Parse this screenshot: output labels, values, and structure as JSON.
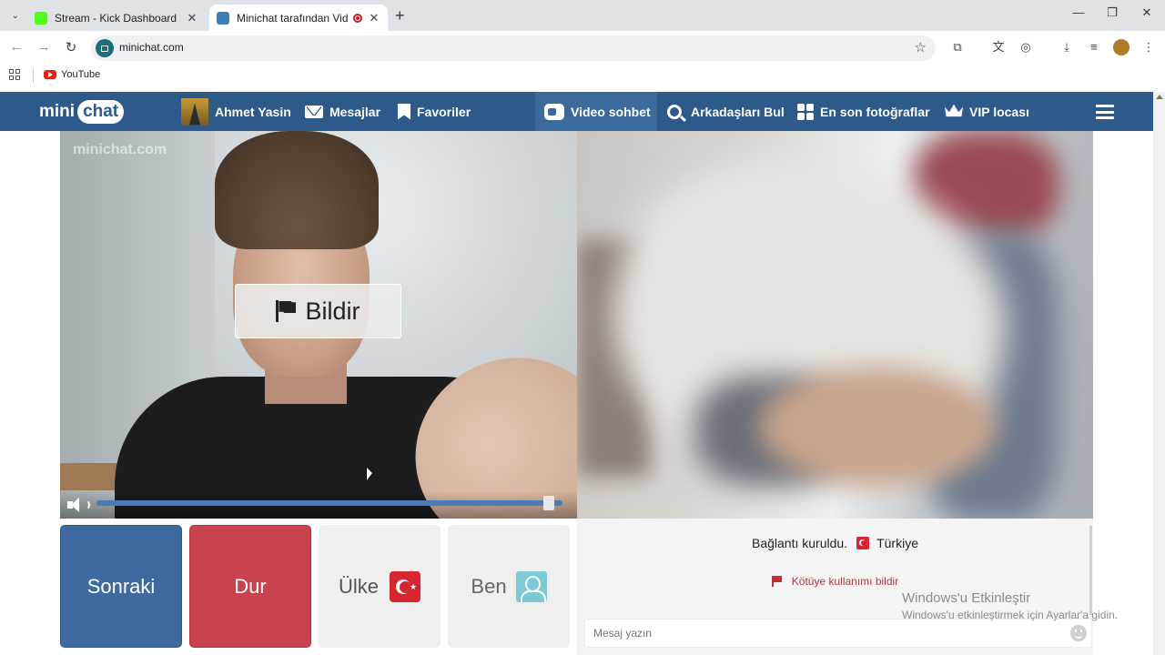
{
  "browser": {
    "tabs": [
      {
        "title": "Stream - Kick Dashboard",
        "favicon_color": "#53fc18",
        "active": false
      },
      {
        "title": "Minichat tarafından Video f",
        "favicon_color": "#3a7fb8",
        "active": true
      }
    ],
    "url": "minichat.com",
    "bookmarks": [
      {
        "label": "YouTube"
      }
    ]
  },
  "site": {
    "logo": {
      "mini": "mini",
      "chat": "chat",
      "watermark": "minichat.com"
    },
    "nav": {
      "user": "Ahmet Yasin",
      "messages": "Mesajlar",
      "favorites": "Favoriler",
      "video_chat": "Video sohbet",
      "find_friends": "Arkadaşları Bul",
      "latest_photos": "En son fotoğraflar",
      "vip": "VIP locası"
    },
    "video": {
      "report_label": "Bildir",
      "volume": 0.97
    },
    "controls": {
      "next": "Sonraki",
      "stop": "Dur",
      "country": "Ülke",
      "me": "Ben"
    },
    "chat": {
      "status": "Bağlantı kuruldu.",
      "country": "Türkiye",
      "report_abuse": "Kötüye kullanımı bildir",
      "placeholder": "Mesaj yazın"
    }
  },
  "os_overlay": {
    "title": "Windows'u Etkinleştir",
    "subtitle": "Windows'u etkinleştirmek için Ayarlar'a gidin."
  },
  "colors": {
    "nav_bg": "#2d5a8a",
    "next_btn": "#3f6aa0",
    "stop_btn": "#c8434e",
    "abuse_link": "#b8333c"
  }
}
